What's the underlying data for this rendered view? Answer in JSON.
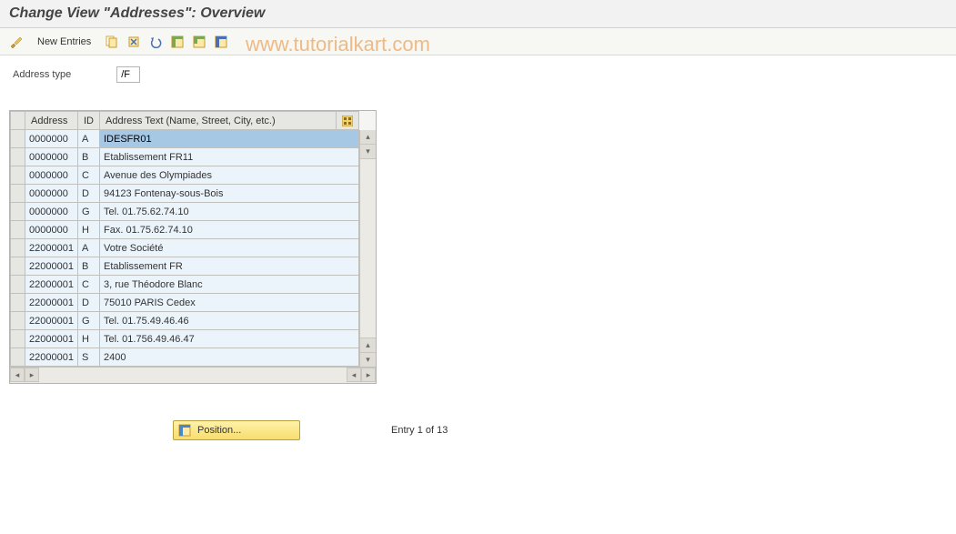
{
  "title": "Change View \"Addresses\": Overview",
  "watermark": "www.tutorialkart.com",
  "toolbar": {
    "new_entries_label": "New Entries"
  },
  "filter": {
    "label": "Address type",
    "value": "/F"
  },
  "columns": {
    "address": "Address",
    "id": "ID",
    "text": "Address Text (Name, Street, City, etc.)"
  },
  "rows": [
    {
      "address": "0000000",
      "id": "A",
      "text": "IDESFR01",
      "selected": true
    },
    {
      "address": "0000000",
      "id": "B",
      "text": "Etablissement FR11"
    },
    {
      "address": "0000000",
      "id": "C",
      "text": "Avenue des Olympiades"
    },
    {
      "address": "0000000",
      "id": "D",
      "text": "94123 Fontenay-sous-Bois"
    },
    {
      "address": "0000000",
      "id": "G",
      "text": "Tel. 01.75.62.74.10"
    },
    {
      "address": "0000000",
      "id": "H",
      "text": "Fax. 01.75.62.74.10"
    },
    {
      "address": "22000001",
      "id": "A",
      "text": "Votre Société"
    },
    {
      "address": "22000001",
      "id": "B",
      "text": "Etablissement FR"
    },
    {
      "address": "22000001",
      "id": "C",
      "text": "3, rue Théodore Blanc"
    },
    {
      "address": "22000001",
      "id": "D",
      "text": "75010 PARIS Cedex"
    },
    {
      "address": "22000001",
      "id": "G",
      "text": "Tel. 01.75.49.46.46"
    },
    {
      "address": "22000001",
      "id": "H",
      "text": "Tel. 01.756.49.46.47"
    },
    {
      "address": "22000001",
      "id": "S",
      "text": "2400"
    }
  ],
  "footer": {
    "position_label": "Position...",
    "entry_text": "Entry 1 of 13"
  }
}
